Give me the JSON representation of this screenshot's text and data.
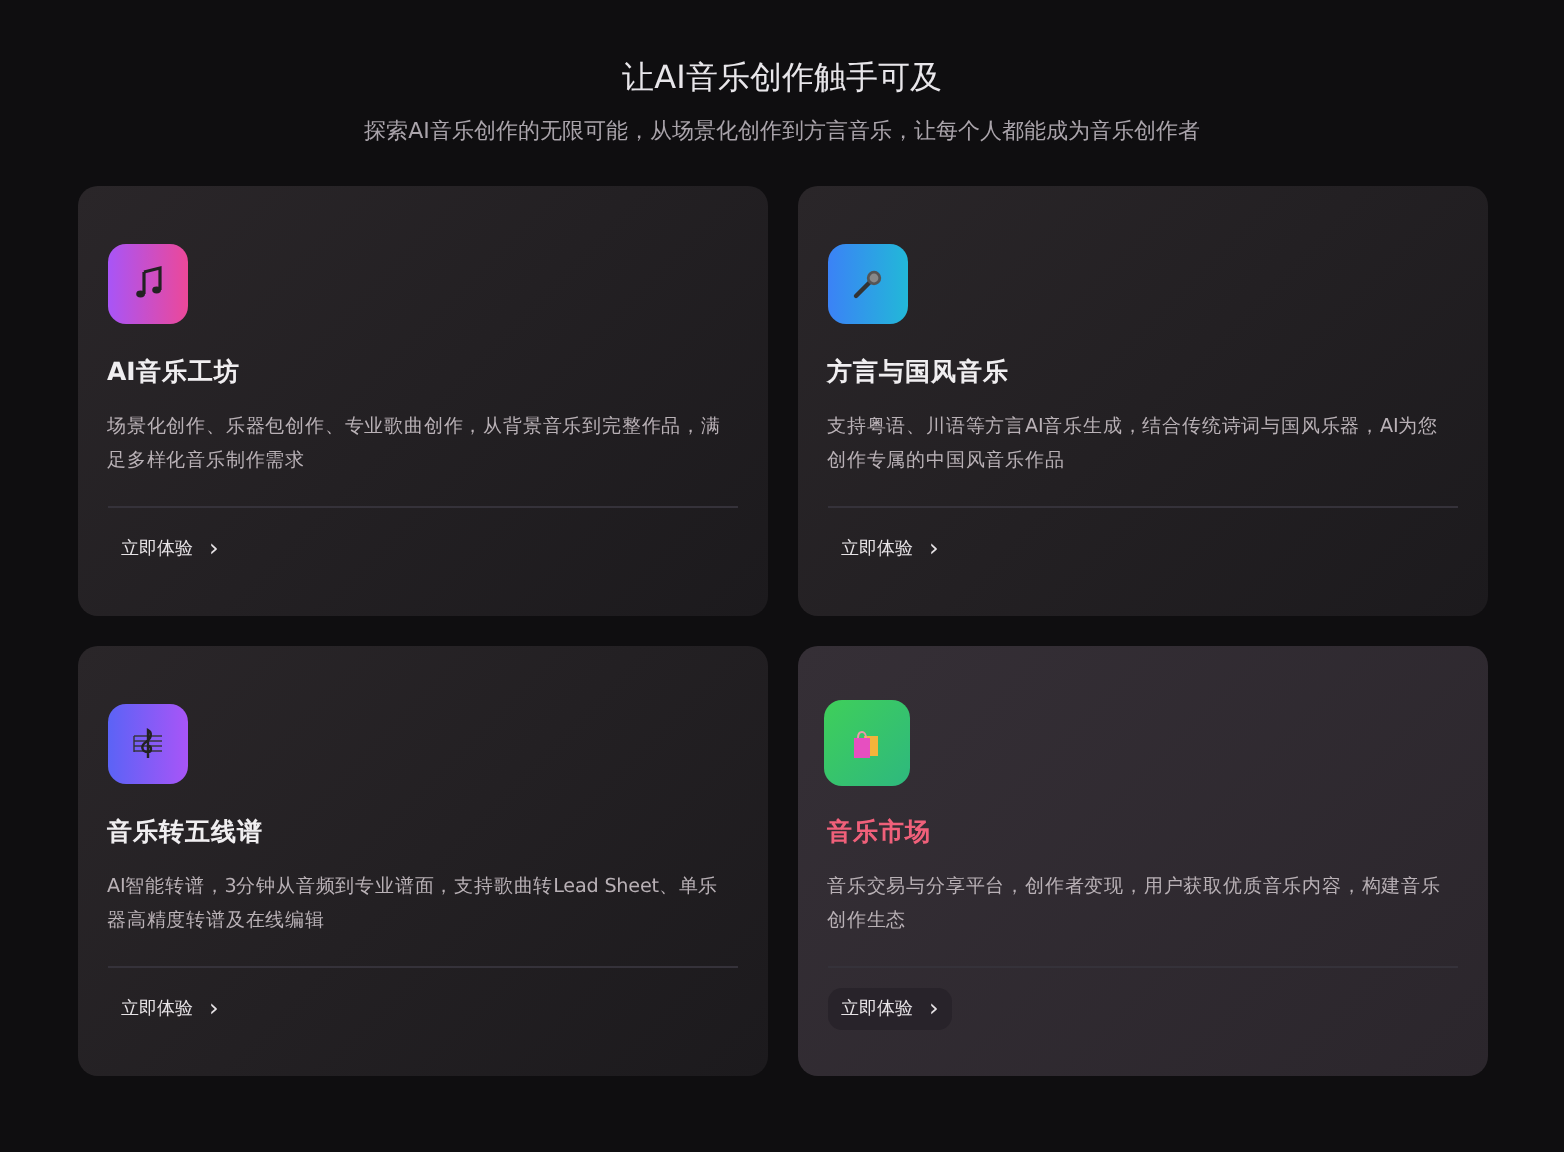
{
  "header": {
    "title": "让AI音乐创作触手可及",
    "subtitle": "探索AI音乐创作的无限可能，从场景化创作到方言音乐，让每个人都能成为音乐创作者"
  },
  "cards": [
    {
      "kind": "note",
      "title": "AI音乐工坊",
      "description": "场景化创作、乐器包创作、专业歌曲创作，从背景音乐到完整作品，满足多样化音乐制作需求",
      "action": "立即体验",
      "chevron": "›",
      "hovered": false
    },
    {
      "kind": "microphone",
      "title": "方言与国风音乐",
      "description": "支持粤语、川语等方言AI音乐生成，结合传统诗词与国风乐器，AI为您创作专属的中国风音乐作品",
      "action": "立即体验",
      "chevron": "›",
      "hovered": false
    },
    {
      "kind": "clef",
      "title": "音乐转五线谱",
      "description": "AI智能转谱，3分钟从音频到专业谱面，支持歌曲转Lead Sheet、单乐器高精度转谱及在线编辑",
      "action": "立即体验",
      "chevron": "›",
      "hovered": false
    },
    {
      "kind": "bags",
      "title": "音乐市场",
      "description": "音乐交易与分享平台，创作者变现，用户获取优质音乐内容，构建音乐创作生态",
      "action": "立即体验",
      "chevron": "›",
      "hovered": true
    }
  ]
}
